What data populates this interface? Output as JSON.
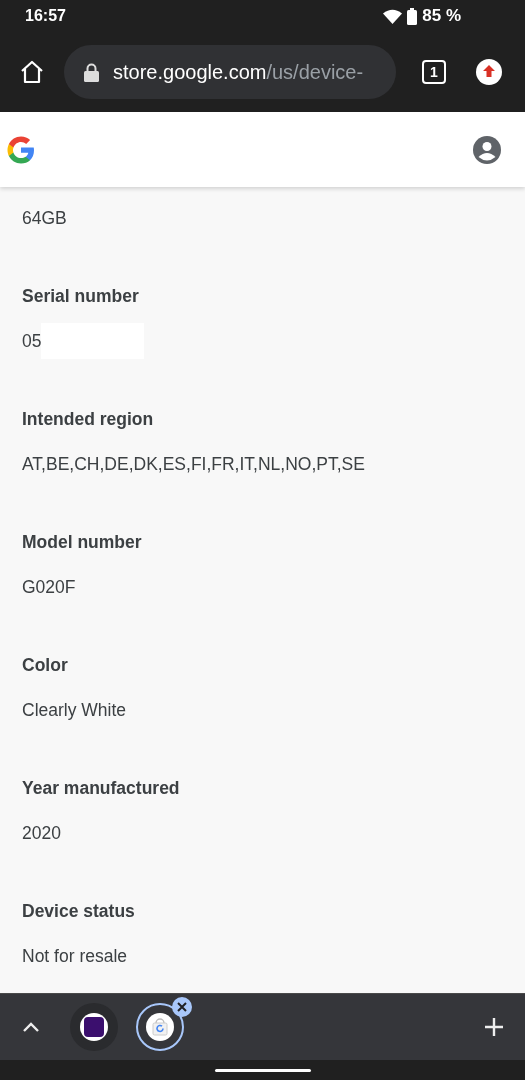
{
  "status_bar": {
    "time": "16:57",
    "battery": "85 %"
  },
  "toolbar": {
    "url_host": "store.google.com",
    "url_path": "/us/device-",
    "tab_count": "1"
  },
  "details": [
    {
      "value": "64GB"
    },
    {
      "label": "Serial number",
      "value": "05",
      "redacted": true
    },
    {
      "label": "Intended region",
      "value": "AT,BE,CH,DE,DK,ES,FI,FR,IT,NL,NO,PT,SE"
    },
    {
      "label": "Model number",
      "value": "G020F"
    },
    {
      "label": "Color",
      "value": "Clearly White"
    },
    {
      "label": "Year manufactured",
      "value": "2020"
    },
    {
      "label": "Device status",
      "value": "Not for resale"
    }
  ],
  "tab_strip": {
    "tabs": [
      {
        "kind": "purple",
        "selected": false
      },
      {
        "kind": "shop",
        "selected": true
      }
    ]
  }
}
